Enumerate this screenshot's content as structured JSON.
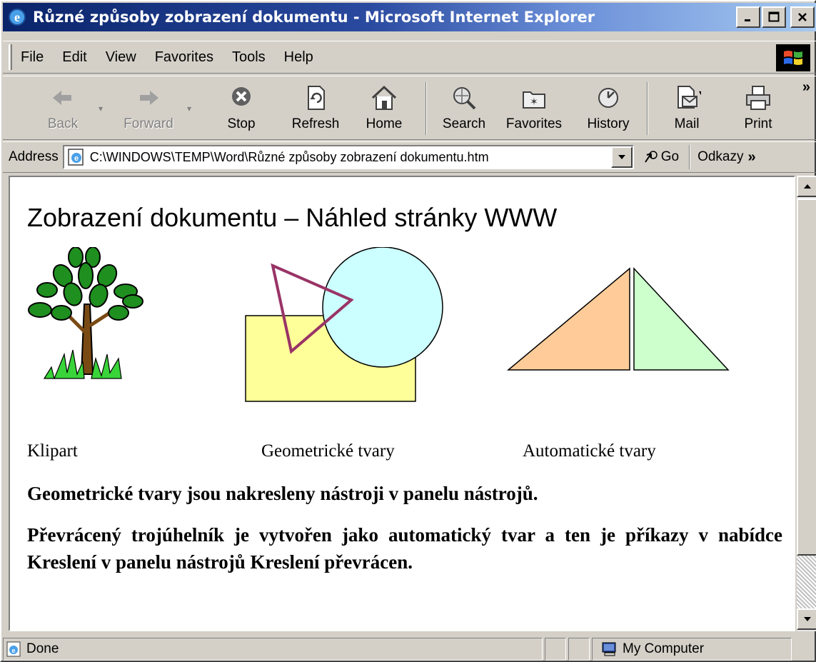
{
  "window": {
    "title": "Různé způsoby zobrazení dokumentu - Microsoft Internet Explorer",
    "minimize_icon": "minimize-icon",
    "maximize_icon": "maximize-icon",
    "close_icon": "close-icon"
  },
  "menu": {
    "items": [
      {
        "label": "File",
        "accel": "F"
      },
      {
        "label": "Edit",
        "accel": "E"
      },
      {
        "label": "View",
        "accel": "V"
      },
      {
        "label": "Favorites",
        "accel": "a"
      },
      {
        "label": "Tools",
        "accel": "T"
      },
      {
        "label": "Help",
        "accel": "H"
      }
    ]
  },
  "toolbar": {
    "back": "Back",
    "forward": "Forward",
    "stop": "Stop",
    "refresh": "Refresh",
    "home": "Home",
    "search": "Search",
    "favorites": "Favorites",
    "history": "History",
    "mail": "Mail",
    "print": "Print"
  },
  "address": {
    "label": "Address",
    "url": "C:\\WINDOWS\\TEMP\\Word\\Různé způsoby zobrazení dokumentu.htm",
    "go": "Go",
    "links": "Odkazy"
  },
  "page": {
    "heading": "Zobrazení dokumentu – Náhled stránky WWW",
    "captions": [
      "Klipart",
      "Geometrické tvary",
      "Automatické tvary"
    ],
    "paragraph1": "Geometrické tvary jsou nakresleny nástroji v panelu nástrojů.",
    "paragraph2": "Převrácený trojúhelník je vytvořen jako automatický tvar a ten je příkazy v nabídce Kreslení v panelu nástrojů Kreslení převrácen."
  },
  "status": {
    "text": "Done",
    "zone": "My Computer"
  },
  "colors": {
    "title_gradient_start": "#0a246a",
    "rect_fill": "#ffff99",
    "circle_fill": "#ccffff",
    "triangle_stroke": "#993366",
    "triangle_left_fill": "#ffcc99",
    "triangle_right_fill": "#ccffcc"
  }
}
